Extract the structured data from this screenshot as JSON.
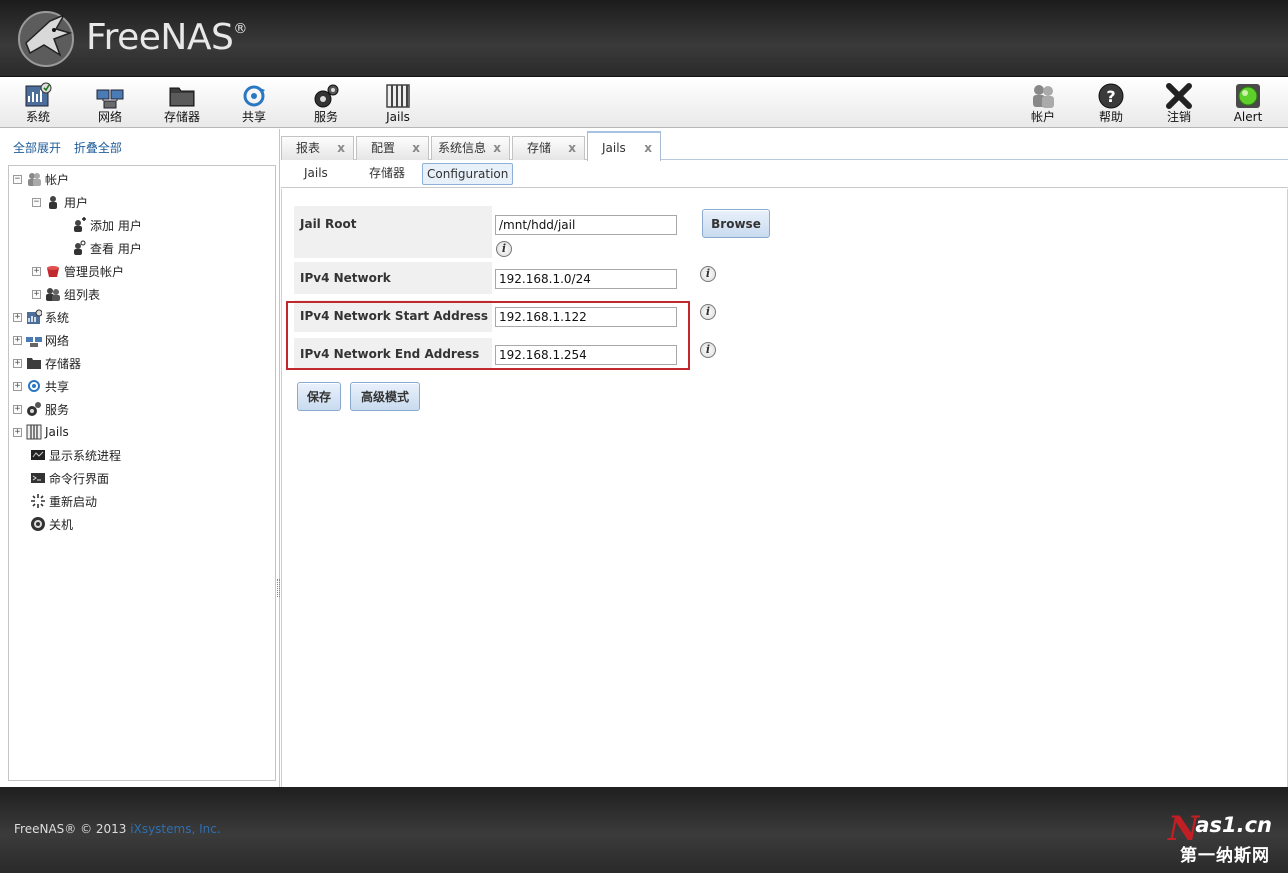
{
  "brand": {
    "name": "FreeNAS",
    "reg": "®"
  },
  "toolbar": {
    "left": [
      {
        "label": "系统",
        "icon": "system-icon"
      },
      {
        "label": "网络",
        "icon": "network-icon"
      },
      {
        "label": "存储器",
        "icon": "storage-icon"
      },
      {
        "label": "共享",
        "icon": "sharing-icon"
      },
      {
        "label": "服务",
        "icon": "services-icon"
      },
      {
        "label": "Jails",
        "icon": "jails-icon"
      }
    ],
    "right": [
      {
        "label": "帐户",
        "icon": "account-icon"
      },
      {
        "label": "帮助",
        "icon": "help-icon"
      },
      {
        "label": "注销",
        "icon": "logout-icon"
      },
      {
        "label": "Alert",
        "icon": "alert-icon"
      }
    ]
  },
  "sidebar": {
    "expand_all": "全部展开",
    "collapse_all": "折叠全部",
    "tree": [
      {
        "label": "帐户",
        "expander": "−"
      },
      {
        "label": "用户",
        "expander": "−"
      },
      {
        "label": "添加 用户"
      },
      {
        "label": "查看 用户"
      },
      {
        "label": "管理员帐户",
        "expander": "+"
      },
      {
        "label": "组列表",
        "expander": "+"
      },
      {
        "label": "系统",
        "expander": "+"
      },
      {
        "label": "网络",
        "expander": "+"
      },
      {
        "label": "存储器",
        "expander": "+"
      },
      {
        "label": "共享",
        "expander": "+"
      },
      {
        "label": "服务",
        "expander": "+"
      },
      {
        "label": "Jails",
        "expander": "+"
      },
      {
        "label": "显示系统进程"
      },
      {
        "label": "命令行界面"
      },
      {
        "label": "重新启动"
      },
      {
        "label": "关机"
      }
    ]
  },
  "tabs": [
    {
      "label": "报表",
      "close": "x"
    },
    {
      "label": "配置",
      "close": "x"
    },
    {
      "label": "系统信息",
      "close": "x"
    },
    {
      "label": "存储",
      "close": "x"
    },
    {
      "label": "Jails",
      "close": "x"
    }
  ],
  "subtabs": [
    "Jails",
    "存储器",
    "Configuration"
  ],
  "form": {
    "jail_root_label": "Jail Root",
    "jail_root_value": "/mnt/hdd/jail",
    "browse": "Browse",
    "ipv4_network_label": "IPv4 Network",
    "ipv4_network_value": "192.168.1.0/24",
    "ipv4_start_label": "IPv4 Network Start Address",
    "ipv4_start_value": "192.168.1.122",
    "ipv4_end_label": "IPv4 Network End Address",
    "ipv4_end_value": "192.168.1.254",
    "info_glyph": "i",
    "save": "保存",
    "advanced": "高级模式"
  },
  "footer": {
    "copyright": "FreeNAS® © 2013",
    "company": "iXsystems, Inc."
  },
  "watermark": {
    "site": "as1.cn",
    "initial": "N",
    "name": "第一纳斯网"
  }
}
